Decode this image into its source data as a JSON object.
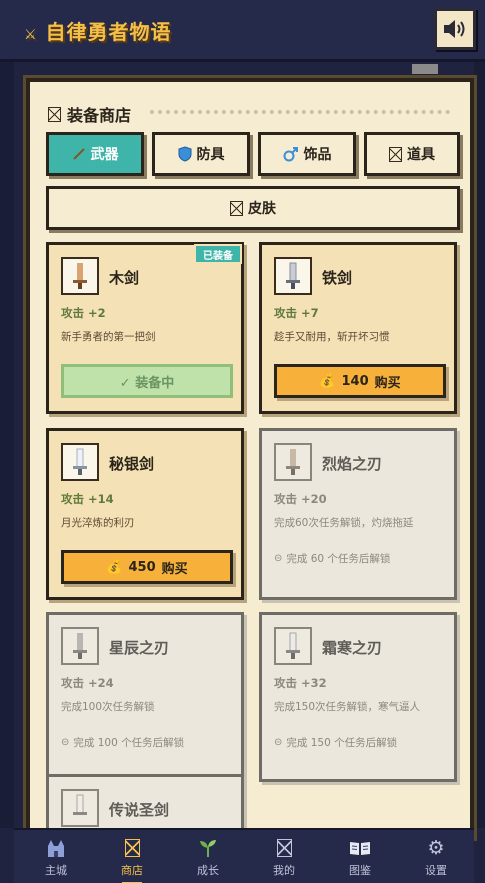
{
  "header": {
    "title": "自律勇者物语",
    "title_icon": "crossed-swords-icon",
    "sound_icon": "speaker-icon"
  },
  "shop": {
    "title": "装备商店",
    "tabs": [
      {
        "label": "武器",
        "icon": "sword-icon",
        "active": true
      },
      {
        "label": "防具",
        "icon": "shield-icon",
        "active": false
      },
      {
        "label": "饰品",
        "icon": "ring-icon",
        "active": false
      },
      {
        "label": "道具",
        "icon": "box-icon",
        "active": false
      },
      {
        "label": "皮肤",
        "icon": "box-icon",
        "active": false
      }
    ],
    "items": [
      {
        "name": "木剑",
        "attack": "攻击 +2",
        "desc": "新手勇者的第一把剑",
        "status": "equipped",
        "badge": "已装备",
        "button": "✓ 装备中",
        "icon": "wood-sword-icon"
      },
      {
        "name": "铁剑",
        "attack": "攻击 +7",
        "desc": "趁手又耐用，斩开坏习惯",
        "status": "buyable",
        "price": "140",
        "button": "购买",
        "icon": "iron-sword-icon"
      },
      {
        "name": "秘银剑",
        "attack": "攻击 +14",
        "desc": "月光淬炼的利刃",
        "status": "buyable",
        "price": "450",
        "button": "购买",
        "icon": "mithril-sword-icon"
      },
      {
        "name": "烈焰之刃",
        "attack": "攻击 +20",
        "desc": "完成60次任务解锁，灼烧拖延",
        "status": "locked",
        "lock_text": "完成 60 个任务后解锁",
        "icon": "flame-blade-icon"
      },
      {
        "name": "星辰之刃",
        "attack": "攻击 +24",
        "desc": "完成100次任务解锁",
        "status": "locked",
        "lock_text": "完成 100 个任务后解锁",
        "icon": "star-blade-icon"
      },
      {
        "name": "霜寒之刃",
        "attack": "攻击 +32",
        "desc": "完成150次任务解锁，寒气逼人",
        "status": "locked",
        "lock_text": "完成 150 个任务后解锁",
        "icon": "frost-blade-icon"
      },
      {
        "name": "传说圣剑",
        "status": "locked",
        "icon": "holy-sword-icon"
      }
    ]
  },
  "nav": [
    {
      "label": "主城",
      "icon": "castle-icon",
      "active": false
    },
    {
      "label": "商店",
      "icon": "box-icon",
      "active": true
    },
    {
      "label": "成长",
      "icon": "sprout-icon",
      "active": false
    },
    {
      "label": "我的",
      "icon": "box-icon",
      "active": false
    },
    {
      "label": "图鉴",
      "icon": "book-icon",
      "active": false
    },
    {
      "label": "设置",
      "icon": "gear-icon",
      "active": false
    }
  ],
  "colors": {
    "header_bg": "#262a4a",
    "title_gold": "#f5c04a",
    "panel_bg": "#f6ecd2",
    "tab_active": "#3fb5aa",
    "buy_button": "#f7b13a",
    "equipped_button": "#bfe1aa",
    "attack_green": "#5f7a3a"
  }
}
